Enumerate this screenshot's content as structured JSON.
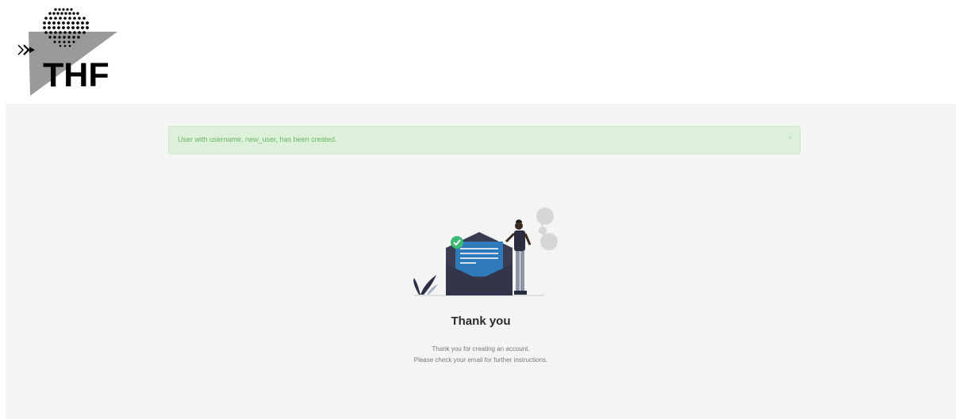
{
  "brand": {
    "logo_text": "THF"
  },
  "alert": {
    "message": "User with username, new_user, has been created.",
    "close_label": "×"
  },
  "content": {
    "title": "Thank you",
    "line1": "Thank you for creating an account.",
    "line2": "Please check your email for further instructions."
  },
  "colors": {
    "alert_bg": "#dcf0da",
    "alert_text": "#6db56a",
    "main_bg": "#f4f4f4",
    "envelope": "#3a3d52",
    "letter": "#2f7ab9",
    "check": "#3cba76"
  },
  "icons": [
    "brand-logo-icon",
    "close-icon",
    "envelope-illustration",
    "check-icon"
  ]
}
